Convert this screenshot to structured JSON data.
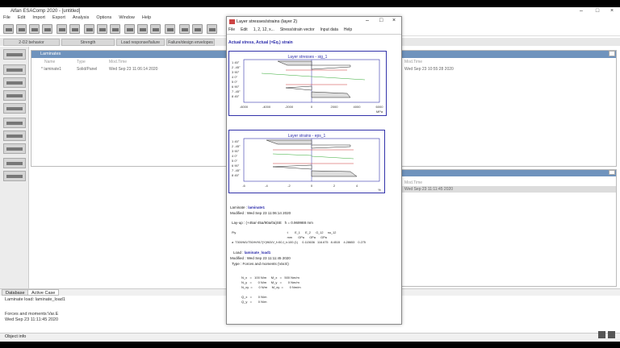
{
  "app": {
    "title": "Alfan ESAComp 2020 - [untitled]"
  },
  "menu": [
    "File",
    "Edit",
    "Import",
    "Export",
    "Analysis",
    "Options",
    "Window",
    "Help"
  ],
  "tabs": [
    "2-D2 behavior",
    "Strength",
    "Load response/failure",
    "Failure/design envelopes"
  ],
  "laminates_panel": {
    "title": "Laminates",
    "headers": [
      "Name",
      "Type",
      "Mod.Time",
      "Mod.Time"
    ],
    "row": {
      "name": "* laminate1",
      "type": "Solid/Panel",
      "modtime": "Wed Sep 23 11:06:14 2020",
      "modtime2": "Wed Sep 23 10:55:28 2020"
    }
  },
  "loads_panel": {
    "header": "Mod.Time",
    "value": "Wed Sep 23 11:11:45 2020"
  },
  "bottom_tabs": [
    "Database",
    "Active Case"
  ],
  "info_lines": [
    "Laminate load: laminate_load1",
    "",
    "Forces and moments:Var.E",
    "Wed Sep 23 11:11:45 2020"
  ],
  "status": "Object info",
  "dialog": {
    "title": "Layer stresses/strains (layer 2)",
    "menu": [
      "File",
      "Edit",
      "1, 2, 12, x...",
      "Stress/strain vector",
      "Input data",
      "Help"
    ],
    "subtitle": "Actual stress, Actual (=Eq.) strain",
    "stress_chart_title": "Layer stresses - sig_1",
    "strain_chart_title": "Layer strains - eps_1",
    "layer_labels": [
      "1  45°",
      "2  -45°",
      "3  90°",
      "4  0°",
      "5  0°",
      "6  90°",
      "7  -45°",
      "8  45°"
    ],
    "stress_ticks": [
      "-6000",
      "-4000",
      "-2000",
      "0",
      "2000",
      "4000",
      "6000"
    ],
    "stress_unit": "MPa",
    "strain_ticks": [
      "-6",
      "-4",
      "-2",
      "0",
      "2",
      "4"
    ],
    "strain_unit": "%",
    "laminate_label": "Laminate : ",
    "laminate_name": "laminate1",
    "modified": "Modified : Wed Sep 23 11:06:14 2020",
    "layup": "Lay-up : (+45a/-45a/90a/0a)SE   h = 0.969988 mm",
    "ply_header": "Ply                                                            t        E_1      E_2      G_12     nu_12",
    "ply_units": "                                                                 mm       GPa      GPa      GPa",
    "ply_row": "a  T300/M1/T50/H/917(Y)963/V_f=50,f_t=100 (1)     0.113636   116.675   8.4515    4.28653    0.275",
    "load_label": "Load : ",
    "load_name": "laminate_load1",
    "load_modified": "Modified : Wed Sep 23 11:11:45 2020",
    "load_type": "Type : Forces and moments (Var.E)",
    "forces": [
      "N_x   =   100 N/m     M_x   =   500 Nm/m",
      "N_y   =       0 N/m     M_y   =       0 Nm/m",
      "N_xy  =       0 N/m     M_xy  =       0 Nm/m",
      "",
      "Q_x   =       0 N/m",
      "Q_y   =       0 N/m"
    ]
  }
}
